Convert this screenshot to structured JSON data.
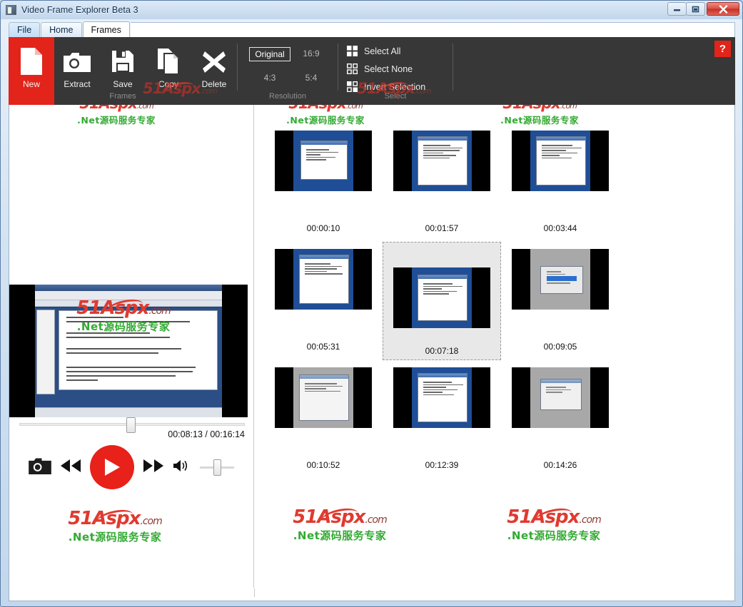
{
  "window": {
    "title": "Video Frame Explorer Beta 3",
    "icon": "app-icon",
    "controls": {
      "minimize": "minimize-icon",
      "maximize": "maximize-icon",
      "close": "close-icon"
    }
  },
  "tabs": [
    {
      "label": "File",
      "active": false
    },
    {
      "label": "Home",
      "active": false
    },
    {
      "label": "Frames",
      "active": true
    }
  ],
  "ribbon": {
    "groups": {
      "frames": {
        "label": "Frames",
        "buttons": [
          {
            "label": "New",
            "icon": "new-file-icon",
            "accent": "#e2241a"
          },
          {
            "label": "Extract",
            "icon": "camera-icon"
          },
          {
            "label": "Save",
            "icon": "floppy-disk-icon"
          },
          {
            "label": "Copy",
            "icon": "copy-pages-icon"
          },
          {
            "label": "Delete",
            "icon": "x-cross-icon"
          }
        ]
      },
      "resolution": {
        "label": "Resolution",
        "options": [
          {
            "label": "Original",
            "selected": true
          },
          {
            "label": "16:9",
            "selected": false
          },
          {
            "label": "4:3",
            "selected": false
          },
          {
            "label": "5:4",
            "selected": false
          }
        ]
      },
      "select": {
        "label": "Select",
        "items": [
          {
            "label": "Select All",
            "icon": "grid-all-filled-icon"
          },
          {
            "label": "Select None",
            "icon": "grid-all-empty-icon"
          },
          {
            "label": "Invert Selection",
            "icon": "grid-checker-icon"
          }
        ]
      }
    },
    "help": {
      "label": "?",
      "icon": "help-icon",
      "color": "#e2241a"
    }
  },
  "player": {
    "current_time": "00:08:13",
    "total_time": "00:16:14",
    "time_display": "00:08:13 / 00:16:14",
    "controls": [
      {
        "name": "snapshot-button",
        "icon": "camera-icon"
      },
      {
        "name": "rewind-button",
        "icon": "rewind-icon"
      },
      {
        "name": "play-button",
        "icon": "play-icon",
        "color": "#e8211a"
      },
      {
        "name": "fast-forward-button",
        "icon": "fast-forward-icon"
      },
      {
        "name": "volume-button",
        "icon": "speaker-icon"
      }
    ]
  },
  "thumbnails": [
    {
      "time": "00:00:10",
      "selected": false,
      "style": "blue-doc"
    },
    {
      "time": "00:01:57",
      "selected": false,
      "style": "blue-doc"
    },
    {
      "time": "00:03:44",
      "selected": false,
      "style": "blue-doc"
    },
    {
      "time": "00:05:31",
      "selected": false,
      "style": "blue-doc"
    },
    {
      "time": "00:07:18",
      "selected": true,
      "style": "blue-doc"
    },
    {
      "time": "00:09:05",
      "selected": false,
      "style": "gray-dialog"
    },
    {
      "time": "00:10:52",
      "selected": false,
      "style": "gray-dialog"
    },
    {
      "time": "00:12:39",
      "selected": false,
      "style": "blue-doc"
    },
    {
      "time": "00:14:26",
      "selected": false,
      "style": "gray-dialog"
    }
  ],
  "watermark": {
    "line1_main": "51Aspx",
    "line1_domain": ".com",
    "line2": ".Net源码服务专家",
    "color_red": "#e03a2f",
    "color_green": "#33aa33"
  }
}
